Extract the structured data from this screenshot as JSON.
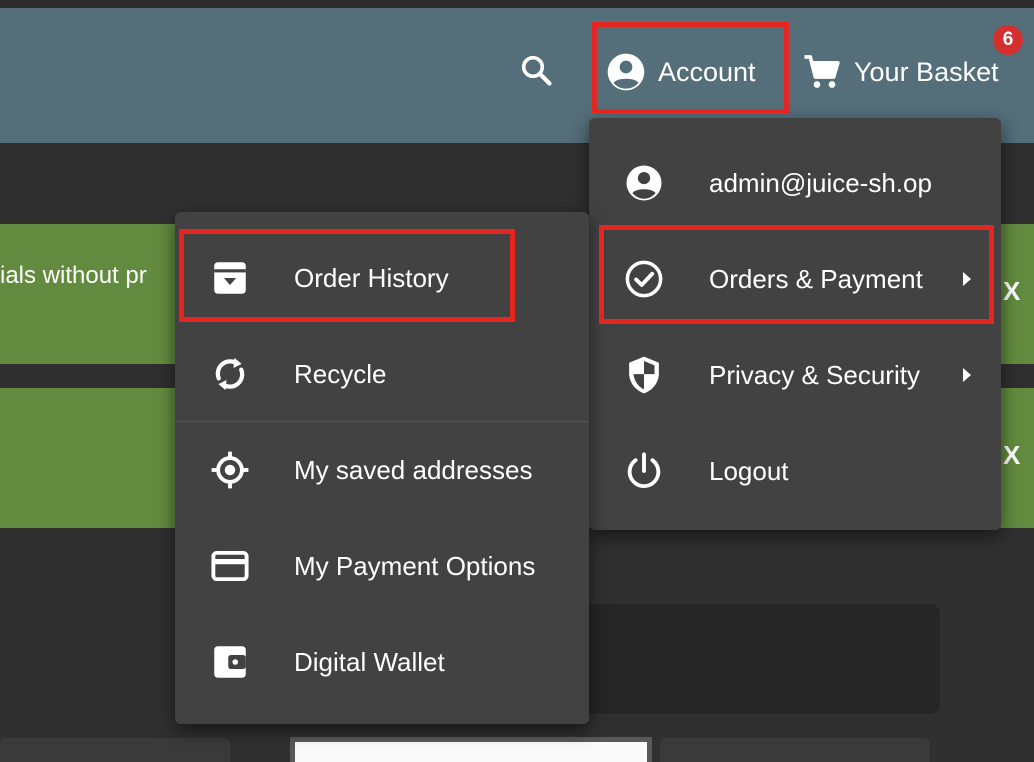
{
  "toolbar": {
    "search_icon": "search-icon",
    "account_label": "Account",
    "basket_label": "Your Basket",
    "basket_count": "6"
  },
  "banners": [
    {
      "text": "ials without pr",
      "close": "X"
    },
    {
      "text": "",
      "close": "X"
    }
  ],
  "account_menu": {
    "items": [
      {
        "label": "admin@juice-sh.op",
        "icon": "account-circle-icon"
      },
      {
        "label": "Orders & Payment",
        "icon": "check-circle-icon",
        "has_submenu": true
      },
      {
        "label": "Privacy & Security",
        "icon": "shield-icon",
        "has_submenu": true
      },
      {
        "label": "Logout",
        "icon": "power-icon"
      }
    ]
  },
  "orders_menu": {
    "items": [
      {
        "label": "Order History",
        "icon": "archive-icon"
      },
      {
        "label": "Recycle",
        "icon": "recycle-icon"
      },
      {
        "label": "My saved addresses",
        "icon": "location-icon"
      },
      {
        "label": "My Payment Options",
        "icon": "credit-card-icon"
      },
      {
        "label": "Digital Wallet",
        "icon": "wallet-icon"
      }
    ]
  },
  "colors": {
    "toolbar": "#546e7a",
    "background": "#303030",
    "menu": "#424242",
    "banner": "#628b3f",
    "highlight": "#e3261f",
    "badge": "#d32f2f"
  }
}
